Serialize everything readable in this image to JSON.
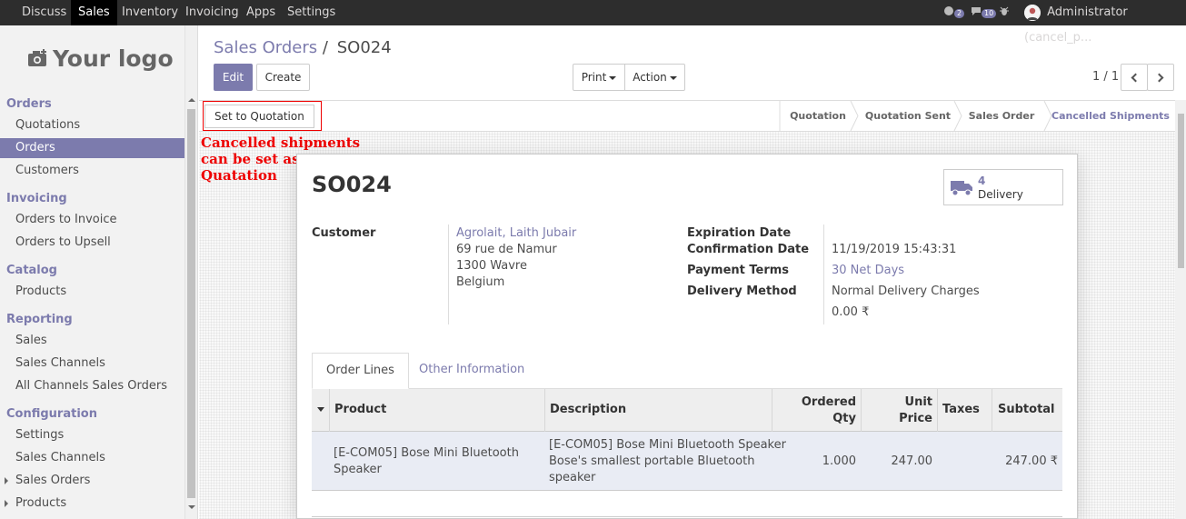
{
  "navbar": {
    "menus": [
      "Discuss",
      "Sales",
      "Inventory",
      "Invoicing",
      "Apps",
      "Settings"
    ],
    "active": "Sales",
    "chat_count": "2",
    "activity_count": "10",
    "user": "Administrator (cancel_p..."
  },
  "sidebar": {
    "logo": "Your logo",
    "sections": [
      {
        "title": "Orders",
        "items": [
          "Quotations",
          "Orders",
          "Customers"
        ]
      },
      {
        "title": "Invoicing",
        "items": [
          "Orders to Invoice",
          "Orders to Upsell"
        ]
      },
      {
        "title": "Catalog",
        "items": [
          "Products"
        ]
      },
      {
        "title": "Reporting",
        "items": [
          "Sales",
          "Sales Channels",
          "All Channels Sales Orders"
        ]
      },
      {
        "title": "Configuration",
        "items": [
          "Settings",
          "Sales Channels",
          "Sales Orders",
          "Products"
        ]
      }
    ],
    "active_item": "Orders"
  },
  "breadcrumb": {
    "parent": "Sales Orders",
    "separator": "/",
    "current": "SO024"
  },
  "buttons": {
    "edit": "Edit",
    "create": "Create",
    "print": "Print",
    "action": "Action"
  },
  "pager": {
    "value": "1 / 1"
  },
  "statusbar": {
    "set_to_quotation": "Set to Quotation",
    "stages": [
      "Quotation",
      "Quotation Sent",
      "Sales Order",
      "Cancelled Shipments"
    ],
    "current_stage": "Cancelled Shipments"
  },
  "annotation": {
    "lines": [
      "Cancelled shipments",
      "can be set as a",
      "Quatation"
    ]
  },
  "form": {
    "title": "SO024",
    "smart_button": {
      "count": "4",
      "label": "Delivery"
    },
    "customer_label": "Customer",
    "customer_name": "Agrolait, Laith Jubair",
    "customer_address": [
      "69 rue de Namur",
      "1300 Wavre",
      "Belgium"
    ],
    "expiration_label": "Expiration Date",
    "confirmation_label": "Confirmation Date",
    "confirmation_value": "11/19/2019 15:43:31",
    "payment_terms_label": "Payment Terms",
    "payment_terms_value": "30 Net Days",
    "delivery_method_label": "Delivery Method",
    "delivery_method_value": "Normal Delivery Charges",
    "delivery_cost": "0.00 ₹"
  },
  "tabs": [
    "Order Lines",
    "Other Information"
  ],
  "table": {
    "headers": {
      "product": "Product",
      "description": "Description",
      "qty1": "Ordered",
      "qty2": "Qty",
      "price1": "Unit",
      "price2": "Price",
      "taxes": "Taxes",
      "subtotal": "Subtotal"
    },
    "rows": [
      {
        "product": [
          "[E-COM05] Bose Mini Bluetooth",
          "Speaker"
        ],
        "description": [
          "[E-COM05] Bose Mini Bluetooth Speaker",
          "Bose's smallest portable Bluetooth",
          "speaker"
        ],
        "qty": "1.000",
        "price": "247.00",
        "taxes": "",
        "subtotal": "247.00 ₹"
      }
    ]
  }
}
